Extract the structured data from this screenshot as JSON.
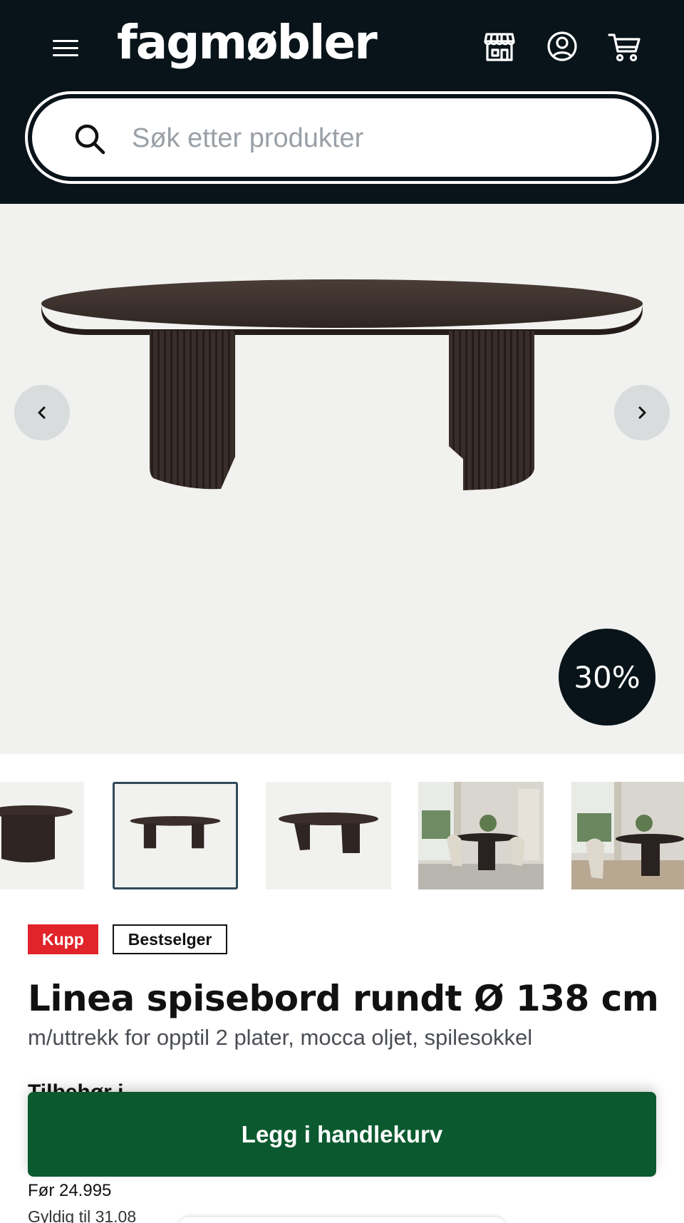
{
  "header": {
    "logo_text": "fagmøbler",
    "menu_icon": "hamburger-menu-icon",
    "store_icon": "store-icon",
    "account_icon": "account-icon",
    "cart_icon": "cart-icon",
    "background_color": "#08141a"
  },
  "search": {
    "placeholder": "Søk etter produkter",
    "icon": "search-icon"
  },
  "gallery": {
    "prev_icon": "chevron-left-icon",
    "next_icon": "chevron-right-icon",
    "discount_badge": "30%",
    "thumbnail_count": 5,
    "active_thumbnail": 2
  },
  "product": {
    "badges": [
      "Kupp",
      "Bestselger"
    ],
    "title": "Linea spisebord rundt Ø 138 cm",
    "subtitle": "m/uttrekk for opptil 2 plater, mocca oljet, spilesokkel",
    "section_heading": "Tilbehør i",
    "price_before": "Før 24.995",
    "valid_until": "Gyldig til 31.08"
  },
  "cta": {
    "add_to_cart_label": "Legg i handlekurv",
    "color": "#0b5a2f"
  },
  "colors": {
    "kupp_badge": "#e0242a",
    "gallery_bg": "#f1f1ef"
  }
}
